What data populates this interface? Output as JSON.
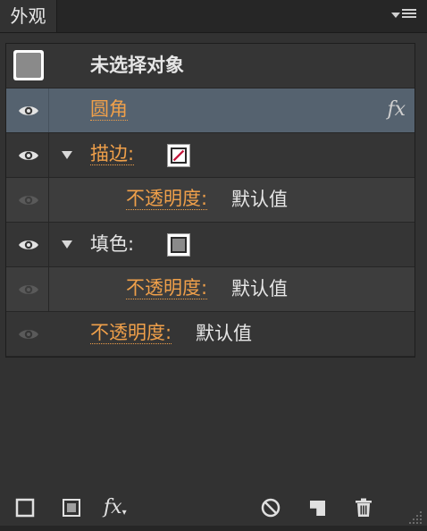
{
  "panel": {
    "tab_title": "外观"
  },
  "header_row": {
    "title": "未选择对象"
  },
  "rows": [
    {
      "label": "圆角",
      "fx": "fx"
    },
    {
      "label": "描边:"
    },
    {
      "label": "不透明度:",
      "value": "默认值"
    },
    {
      "label": "填色:"
    },
    {
      "label": "不透明度:",
      "value": "默认值"
    },
    {
      "label": "不透明度:",
      "value": "默认值"
    }
  ],
  "footer": {
    "fx_label": "fx"
  },
  "colors": {
    "accent_orange": "#f0a04a",
    "selected_row": "#55626f",
    "stroke_slash": "#c4173c",
    "fill_gray": "#8a8a8a"
  }
}
